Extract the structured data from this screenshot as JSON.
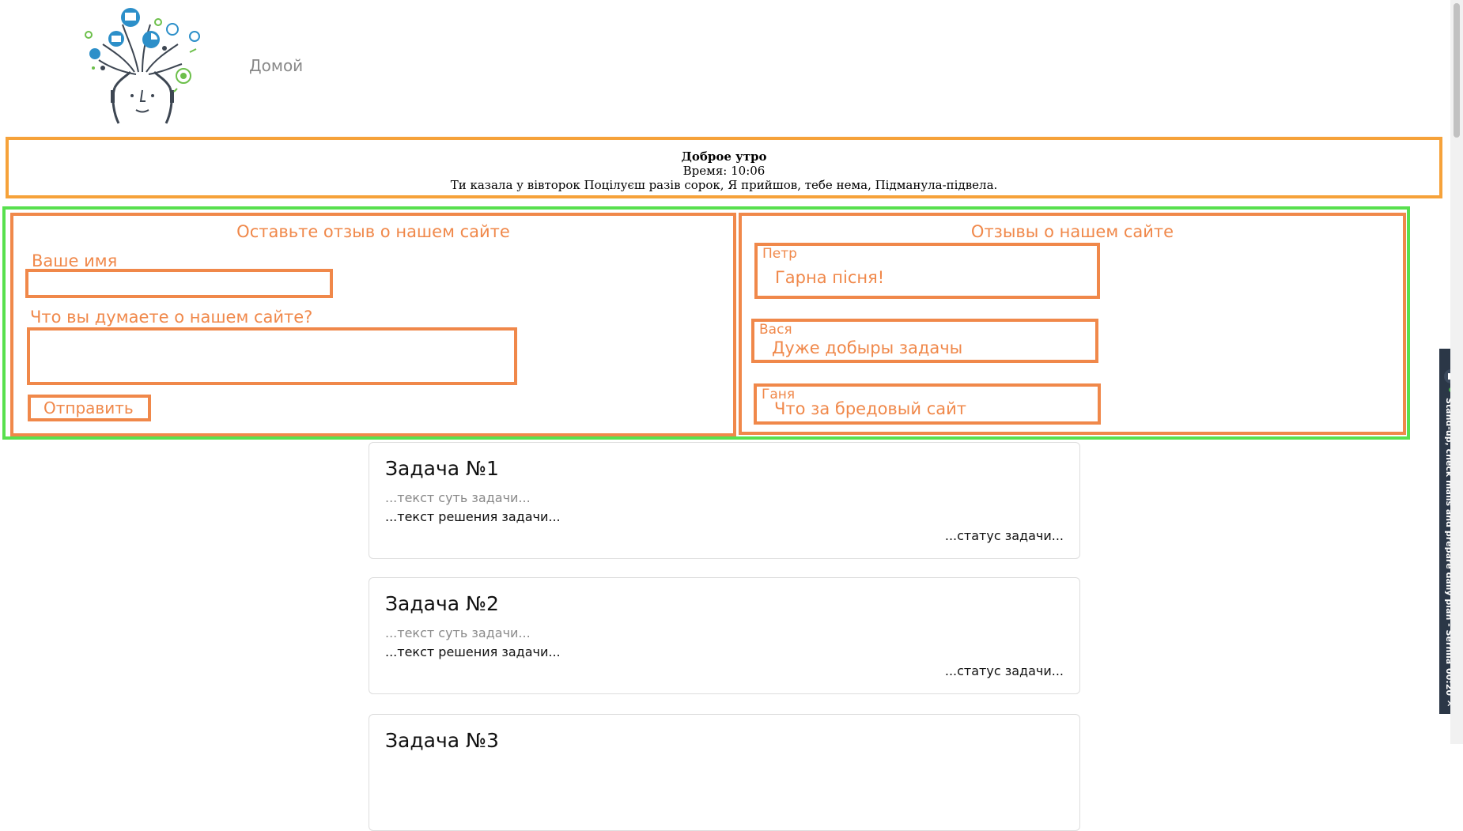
{
  "header": {
    "logo_icon": "head-with-ideas-logo",
    "nav_home": "Домой"
  },
  "greeting": {
    "title": "Доброе утро",
    "time": "Время: 10:06",
    "quote": "Ти казала у вівторок Поцілуєш разів сорок, Я прийшов, тебе нема, Підманула-підвела."
  },
  "feedback_form": {
    "title": "Оставьте отзыв о нашем сайте",
    "name_label": "Ваше имя",
    "name_value": "",
    "comment_label": "Что вы думаете о нашем сайте?",
    "comment_value": "",
    "submit_label": "Отправить"
  },
  "reviews": {
    "title": "Отзывы о нашем сайте",
    "items": [
      {
        "author": "Петр",
        "text": "Гарна пісня!"
      },
      {
        "author": "Вася",
        "text": "Дуже добыры задачы"
      },
      {
        "author": "Ганя",
        "text": "Что за бредовый сайт"
      }
    ]
  },
  "tasks": [
    {
      "title": "Задача №1",
      "essence": "...текст суть задачи...",
      "solution": "...текст решения задачи...",
      "status": "...статус задачи..."
    },
    {
      "title": "Задача №2",
      "essence": "...текст суть задачи...",
      "solution": "...текст решения задачи...",
      "status": "...статус задачи..."
    },
    {
      "title": "Задача №3",
      "essence": "",
      "solution": "",
      "status": ""
    }
  ],
  "side_widget": {
    "title": "Stand-up, check mails and prepare daily plan - Serhiia",
    "timer": "00:20"
  },
  "colors": {
    "orange_border": "#f0884a",
    "greeting_border": "#f6a23a",
    "green_border": "#58e04e",
    "widget_bg": "#2b3747"
  }
}
